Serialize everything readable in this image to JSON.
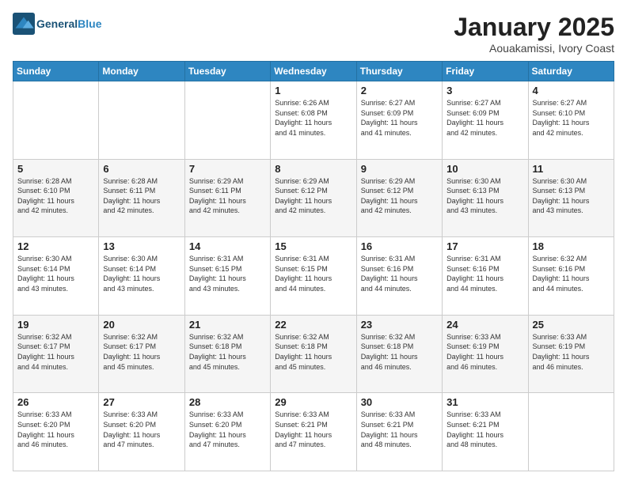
{
  "header": {
    "logo_line1": "General",
    "logo_line2": "Blue",
    "month": "January 2025",
    "location": "Aouakamissi, Ivory Coast"
  },
  "weekdays": [
    "Sunday",
    "Monday",
    "Tuesday",
    "Wednesday",
    "Thursday",
    "Friday",
    "Saturday"
  ],
  "weeks": [
    [
      {
        "day": "",
        "info": ""
      },
      {
        "day": "",
        "info": ""
      },
      {
        "day": "",
        "info": ""
      },
      {
        "day": "1",
        "info": "Sunrise: 6:26 AM\nSunset: 6:08 PM\nDaylight: 11 hours\nand 41 minutes."
      },
      {
        "day": "2",
        "info": "Sunrise: 6:27 AM\nSunset: 6:09 PM\nDaylight: 11 hours\nand 41 minutes."
      },
      {
        "day": "3",
        "info": "Sunrise: 6:27 AM\nSunset: 6:09 PM\nDaylight: 11 hours\nand 42 minutes."
      },
      {
        "day": "4",
        "info": "Sunrise: 6:27 AM\nSunset: 6:10 PM\nDaylight: 11 hours\nand 42 minutes."
      }
    ],
    [
      {
        "day": "5",
        "info": "Sunrise: 6:28 AM\nSunset: 6:10 PM\nDaylight: 11 hours\nand 42 minutes."
      },
      {
        "day": "6",
        "info": "Sunrise: 6:28 AM\nSunset: 6:11 PM\nDaylight: 11 hours\nand 42 minutes."
      },
      {
        "day": "7",
        "info": "Sunrise: 6:29 AM\nSunset: 6:11 PM\nDaylight: 11 hours\nand 42 minutes."
      },
      {
        "day": "8",
        "info": "Sunrise: 6:29 AM\nSunset: 6:12 PM\nDaylight: 11 hours\nand 42 minutes."
      },
      {
        "day": "9",
        "info": "Sunrise: 6:29 AM\nSunset: 6:12 PM\nDaylight: 11 hours\nand 42 minutes."
      },
      {
        "day": "10",
        "info": "Sunrise: 6:30 AM\nSunset: 6:13 PM\nDaylight: 11 hours\nand 43 minutes."
      },
      {
        "day": "11",
        "info": "Sunrise: 6:30 AM\nSunset: 6:13 PM\nDaylight: 11 hours\nand 43 minutes."
      }
    ],
    [
      {
        "day": "12",
        "info": "Sunrise: 6:30 AM\nSunset: 6:14 PM\nDaylight: 11 hours\nand 43 minutes."
      },
      {
        "day": "13",
        "info": "Sunrise: 6:30 AM\nSunset: 6:14 PM\nDaylight: 11 hours\nand 43 minutes."
      },
      {
        "day": "14",
        "info": "Sunrise: 6:31 AM\nSunset: 6:15 PM\nDaylight: 11 hours\nand 43 minutes."
      },
      {
        "day": "15",
        "info": "Sunrise: 6:31 AM\nSunset: 6:15 PM\nDaylight: 11 hours\nand 44 minutes."
      },
      {
        "day": "16",
        "info": "Sunrise: 6:31 AM\nSunset: 6:16 PM\nDaylight: 11 hours\nand 44 minutes."
      },
      {
        "day": "17",
        "info": "Sunrise: 6:31 AM\nSunset: 6:16 PM\nDaylight: 11 hours\nand 44 minutes."
      },
      {
        "day": "18",
        "info": "Sunrise: 6:32 AM\nSunset: 6:16 PM\nDaylight: 11 hours\nand 44 minutes."
      }
    ],
    [
      {
        "day": "19",
        "info": "Sunrise: 6:32 AM\nSunset: 6:17 PM\nDaylight: 11 hours\nand 44 minutes."
      },
      {
        "day": "20",
        "info": "Sunrise: 6:32 AM\nSunset: 6:17 PM\nDaylight: 11 hours\nand 45 minutes."
      },
      {
        "day": "21",
        "info": "Sunrise: 6:32 AM\nSunset: 6:18 PM\nDaylight: 11 hours\nand 45 minutes."
      },
      {
        "day": "22",
        "info": "Sunrise: 6:32 AM\nSunset: 6:18 PM\nDaylight: 11 hours\nand 45 minutes."
      },
      {
        "day": "23",
        "info": "Sunrise: 6:32 AM\nSunset: 6:18 PM\nDaylight: 11 hours\nand 46 minutes."
      },
      {
        "day": "24",
        "info": "Sunrise: 6:33 AM\nSunset: 6:19 PM\nDaylight: 11 hours\nand 46 minutes."
      },
      {
        "day": "25",
        "info": "Sunrise: 6:33 AM\nSunset: 6:19 PM\nDaylight: 11 hours\nand 46 minutes."
      }
    ],
    [
      {
        "day": "26",
        "info": "Sunrise: 6:33 AM\nSunset: 6:20 PM\nDaylight: 11 hours\nand 46 minutes."
      },
      {
        "day": "27",
        "info": "Sunrise: 6:33 AM\nSunset: 6:20 PM\nDaylight: 11 hours\nand 47 minutes."
      },
      {
        "day": "28",
        "info": "Sunrise: 6:33 AM\nSunset: 6:20 PM\nDaylight: 11 hours\nand 47 minutes."
      },
      {
        "day": "29",
        "info": "Sunrise: 6:33 AM\nSunset: 6:21 PM\nDaylight: 11 hours\nand 47 minutes."
      },
      {
        "day": "30",
        "info": "Sunrise: 6:33 AM\nSunset: 6:21 PM\nDaylight: 11 hours\nand 48 minutes."
      },
      {
        "day": "31",
        "info": "Sunrise: 6:33 AM\nSunset: 6:21 PM\nDaylight: 11 hours\nand 48 minutes."
      },
      {
        "day": "",
        "info": ""
      }
    ]
  ]
}
